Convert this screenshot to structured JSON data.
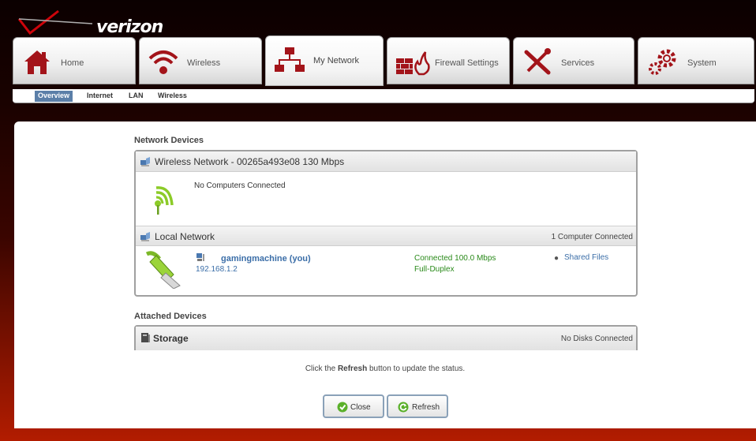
{
  "brand": {
    "name": "verizon",
    "accent": "#cd040b"
  },
  "tabs": [
    {
      "label": "Home",
      "icon": "house-icon"
    },
    {
      "label": "Wireless",
      "icon": "wifi-icon"
    },
    {
      "label": "My Network",
      "icon": "network-icon",
      "active": true
    },
    {
      "label": "Firewall Settings",
      "icon": "firewall-icon"
    },
    {
      "label": "Services",
      "icon": "tools-icon"
    },
    {
      "label": "System",
      "icon": "gears-icon"
    }
  ],
  "subnav": [
    "Overview",
    "Internet",
    "LAN",
    "Wireless"
  ],
  "network_devices": {
    "title": "Network Devices",
    "wireless": {
      "title": "Wireless Network - 00265a493e08 130 Mbps",
      "status": "No Computers Connected"
    },
    "local": {
      "title": "Local Network",
      "count": "1 Computer Connected",
      "device": {
        "name": "gamingmachine (you)",
        "ip": "192.168.1.2",
        "connection_line1": "Connected 100.0 Mbps",
        "connection_line2": "Full-Duplex",
        "shared": "Shared Files"
      }
    }
  },
  "attached_devices": {
    "title": "Attached Devices",
    "storage": {
      "title": "Storage",
      "status": "No Disks Connected"
    }
  },
  "hint": {
    "before": "Click the ",
    "bold": "Refresh",
    "after": " button to update the status."
  },
  "buttons": {
    "close": "Close",
    "refresh": "Refresh"
  }
}
